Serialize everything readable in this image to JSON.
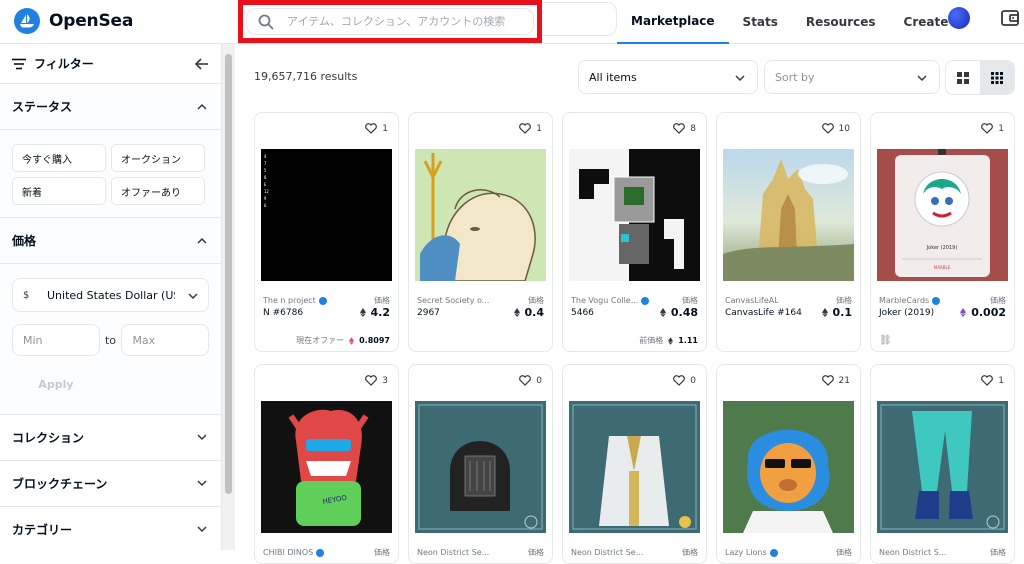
{
  "header": {
    "logo_text": "OpenSea",
    "search_placeholder": "アイテム、コレクション、アカウントの検索",
    "nav": [
      "Marketplace",
      "Stats",
      "Resources",
      "Create"
    ]
  },
  "sidebar": {
    "filter_title": "フィルター",
    "status_title": "ステータス",
    "status_buttons": [
      "今すぐ購入",
      "オークション",
      "新着",
      "オファーあり"
    ],
    "price_title": "価格",
    "currency_symbol": "$",
    "currency": "United States Dollar (USD)",
    "min_placeholder": "Min",
    "to_label": "to",
    "max_placeholder": "Max",
    "apply_label": "Apply",
    "sections": [
      "コレクション",
      "ブロックチェーン",
      "カテゴリー"
    ]
  },
  "main": {
    "results": "19,657,716 results",
    "all_items": "All items",
    "sort_by": "Sort by"
  },
  "cards": [
    {
      "likes": "1",
      "collection": "The n project",
      "name": "N #6786",
      "price_label": "価格",
      "price": "4.2",
      "foot_label": "現在オファー",
      "foot_value": "0.8097",
      "bg": "#000000"
    },
    {
      "likes": "1",
      "collection": "Secret Society o...",
      "name": "2967",
      "price_label": "価格",
      "price": "0.4",
      "bg": "#cde6b4"
    },
    {
      "likes": "8",
      "collection": "The Vogu Colle...",
      "name": "5466",
      "price_label": "価格",
      "price": "0.48",
      "foot_label": "前価格",
      "foot_value": "1.11",
      "bg": "#111111"
    },
    {
      "likes": "10",
      "collection": "CanvasLifeAL",
      "name": "CanvasLife #164",
      "price_label": "価格",
      "price": "0.1",
      "bg": "#b9d6ea"
    },
    {
      "likes": "1",
      "collection": "MarbleCards",
      "name": "Joker (2019)",
      "price_label": "価格",
      "price": "0.002",
      "bg": "#a44d4a"
    },
    {
      "likes": "3",
      "collection": "CHIBI DINOS",
      "bg": "#111111"
    },
    {
      "likes": "0",
      "collection": "Neon District Se...",
      "bg": "#3e6a73"
    },
    {
      "likes": "0",
      "collection": "Neon District Se...",
      "bg": "#3e6a73"
    },
    {
      "likes": "21",
      "collection": "Lazy Lions",
      "bg": "#4f7a4c"
    },
    {
      "likes": "1",
      "collection": "Neon District S...",
      "bg": "#3e6a73"
    }
  ],
  "colors": {
    "accent": "#2081e2",
    "highlight_box": "#e8101a"
  }
}
